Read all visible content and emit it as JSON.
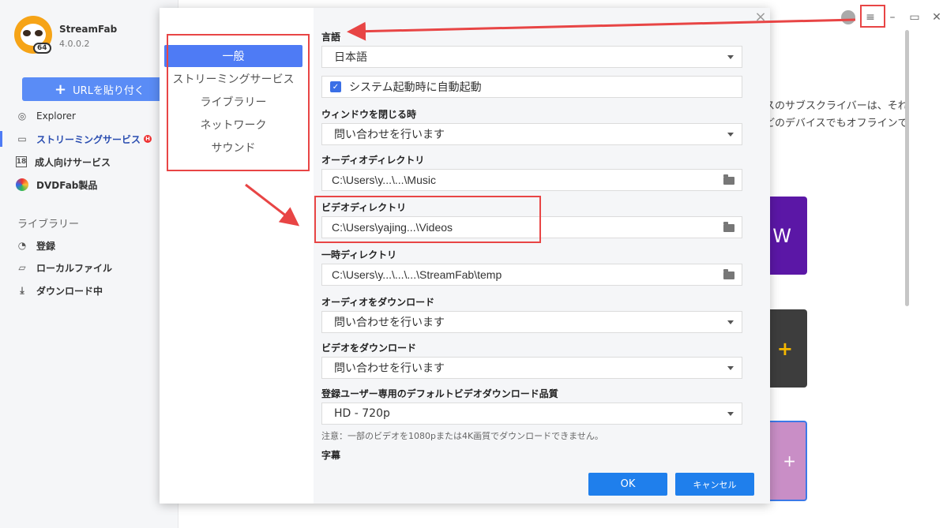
{
  "app": {
    "name": "StreamFab",
    "version": "4.0.0.2",
    "logo_badge": "64"
  },
  "sidebar": {
    "paste_button": "URLを貼り付く",
    "items": [
      {
        "label": "Explorer",
        "icon": "globe-icon"
      },
      {
        "label": "ストリーミングサービス",
        "icon": "tv-icon",
        "badge": "H"
      },
      {
        "label": "成人向けサービス",
        "icon": "18-icon"
      },
      {
        "label": "DVDFab製品",
        "icon": "dvdfab-icon"
      }
    ],
    "library_label": "ライブラリー",
    "library_items": [
      {
        "label": "登録",
        "icon": "rss-icon"
      },
      {
        "label": "ローカルファイル",
        "icon": "folder-icon"
      },
      {
        "label": "ダウンロード中",
        "icon": "download-icon"
      }
    ]
  },
  "main": {
    "text_line1": "スのサブスクライバーは、それ",
    "text_line2": "どのデバイスでもオフラインで",
    "tile1_text": "W",
    "tile2_text": "+",
    "tile3_text": "+"
  },
  "settings": {
    "nav": [
      "一般",
      "ストリーミングサービス",
      "ライブラリー",
      "ネットワーク",
      "サウンド"
    ],
    "selected_nav": "一般",
    "language_label": "言語",
    "language_value": "日本語",
    "autostart_label": "システム起動時に自動起動",
    "close_window_label": "ウィンドウを閉じる時",
    "close_window_value": "問い合わせを行います",
    "audio_dir_label": "オーディオディレクトリ",
    "audio_dir_value": "C:\\Users\\y...\\...\\Music",
    "video_dir_label": "ビデオディレクトリ",
    "video_dir_value": "C:\\Users\\yajing...\\Videos",
    "temp_dir_label": "一時ディレクトリ",
    "temp_dir_value": "C:\\Users\\y...\\...\\...\\StreamFab\\temp",
    "download_audio_label": "オーディオをダウンロード",
    "download_audio_value": "問い合わせを行います",
    "download_video_label": "ビデオをダウンロード",
    "download_video_value": "問い合わせを行います",
    "quality_label": "登録ユーザー専用のデフォルトビデオダウンロード品質",
    "quality_value": "HD - 720p",
    "quality_note": "注意：一部のビデオを1080pまたは4K画質でダウンロードできません。",
    "subtitle_label": "字幕",
    "ok_label": "OK",
    "cancel_label": "キャンセル"
  },
  "colors": {
    "accent": "#4e7bf5",
    "button_blue": "#1f7fec",
    "annotation_red": "#e84545"
  }
}
